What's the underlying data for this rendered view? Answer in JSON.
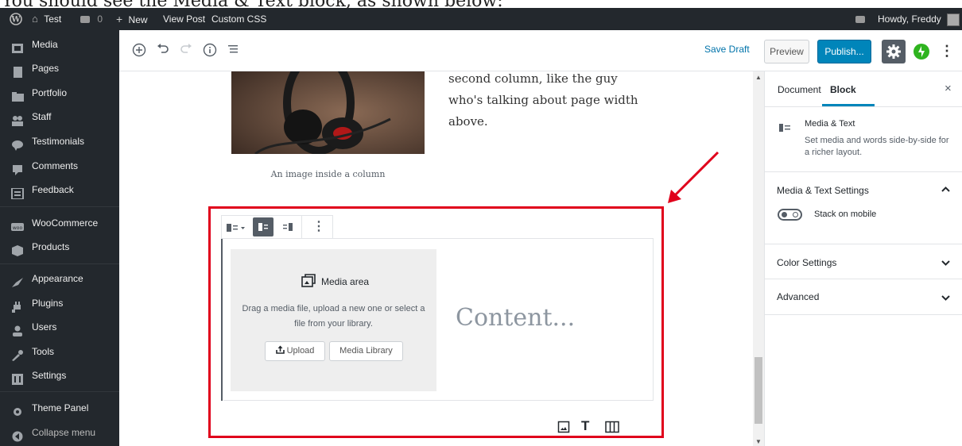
{
  "caption": {
    "text": "You should see the Media & Text block, as shown below:"
  },
  "admin_bar": {
    "site_name": "Test",
    "comments_count": "0",
    "new_label": "New",
    "view_post_label": "View Post",
    "custom_css_label": "Custom CSS",
    "howdy_label": "Howdy, Freddy"
  },
  "admin_menu": [
    {
      "label": "Media",
      "icon": "media-icon"
    },
    {
      "label": "Pages",
      "icon": "pages-icon"
    },
    {
      "label": "Portfolio",
      "icon": "portfolio-icon"
    },
    {
      "label": "Staff",
      "icon": "staff-icon"
    },
    {
      "label": "Testimonials",
      "icon": "testimonials-icon"
    },
    {
      "label": "Comments",
      "icon": "comments-icon"
    },
    {
      "label": "Feedback",
      "icon": "feedback-icon"
    },
    {
      "label": "WooCommerce",
      "icon": "woocommerce-icon"
    },
    {
      "label": "Products",
      "icon": "products-icon"
    },
    {
      "label": "Appearance",
      "icon": "appearance-icon"
    },
    {
      "label": "Plugins",
      "icon": "plugins-icon"
    },
    {
      "label": "Users",
      "icon": "users-icon"
    },
    {
      "label": "Tools",
      "icon": "tools-icon"
    },
    {
      "label": "Settings",
      "icon": "settings-icon"
    },
    {
      "label": "Theme Panel",
      "icon": "theme-panel-icon"
    },
    {
      "label": "Collapse menu",
      "icon": "collapse-icon"
    }
  ],
  "editor_toolbar": {
    "save_draft_label": "Save Draft",
    "preview_label": "Preview",
    "publish_label": "Publish..."
  },
  "canvas": {
    "column_text": "second column, like the guy who's talking about page width above.",
    "image_caption": "An image inside a column"
  },
  "media_text_block": {
    "media_area_title": "Media area",
    "media_area_desc": "Drag a media file, upload a new one or select a file from your library.",
    "upload_label": "Upload",
    "media_library_label": "Media Library",
    "content_placeholder": "Content..."
  },
  "sidebar": {
    "tab_document": "Document",
    "tab_block": "Block",
    "block_name": "Media & Text",
    "block_desc": "Set media and words side-by-side for a richer layout.",
    "panels": {
      "media_text_settings": "Media & Text Settings",
      "stack_on_mobile": "Stack on mobile",
      "color_settings": "Color Settings",
      "advanced": "Advanced"
    }
  },
  "colors": {
    "admin_dark": "#23282d",
    "wp_blue": "#0085ba",
    "link_blue": "#0073aa",
    "highlight_red": "#e0001b"
  }
}
